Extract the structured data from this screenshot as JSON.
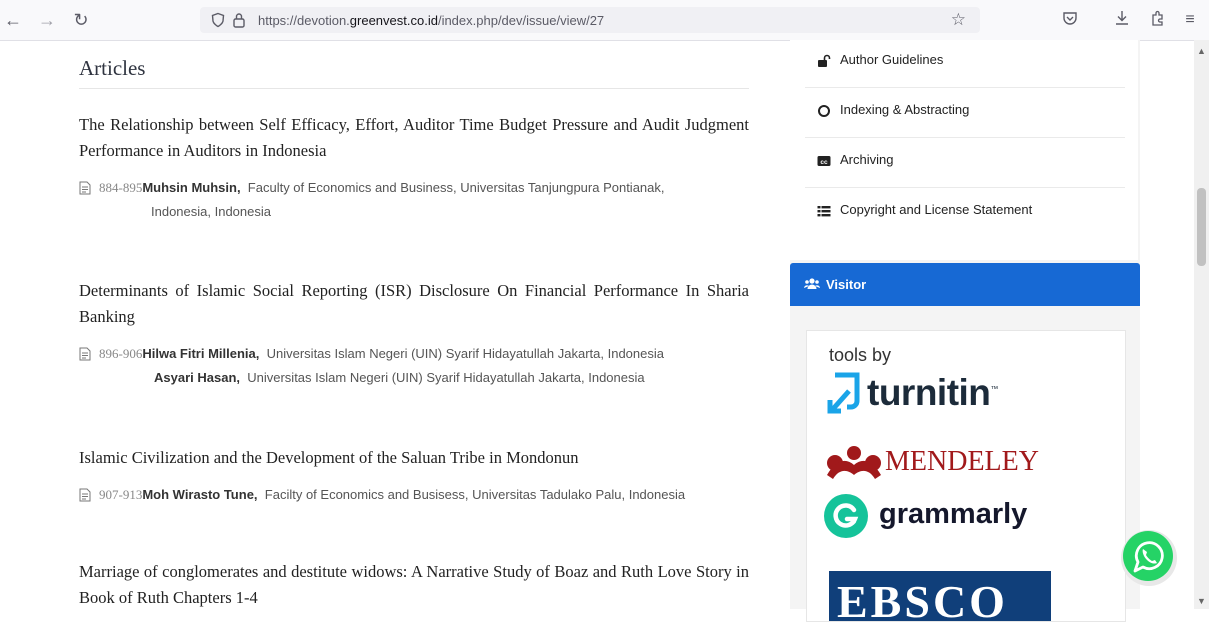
{
  "browser": {
    "url_prefix": "https://devotion.",
    "url_domain": "greenvest.co.id",
    "url_path": "/index.php/dev/issue/view/27"
  },
  "main": {
    "section_title": "Articles",
    "articles": [
      {
        "title": "The Relationship between Self Efficacy, Effort, Auditor Time Budget Pressure and Audit Judgment Performance in Auditors in Indonesia",
        "pages": "884-895",
        "author1": "Muhsin Muhsin,",
        "affil1": "Faculty of Economics and Business, Universitas Tanjungpura Pontianak,",
        "affil1_cont": "Indonesia,  Indonesia"
      },
      {
        "title": "Determinants of Islamic Social Reporting (ISR) Disclosure On Financial Performance In Sharia Banking",
        "pages": "896-906",
        "author1": "Hilwa Fitri Millenia,",
        "affil1": "Universitas Islam Negeri (UIN) Syarif Hidayatullah Jakarta,  Indonesia",
        "author2": "Asyari Hasan,",
        "affil2": "Universitas Islam Negeri (UIN) Syarif Hidayatullah Jakarta,  Indonesia"
      },
      {
        "title": "Islamic Civilization and the Development of the Saluan Tribe in Mondonun",
        "pages": "907-913",
        "author1": "Moh Wirasto Tune,",
        "affil1": "Facilty of Economics and Busisess, Universitas Tadulako Palu,  Indonesia"
      },
      {
        "title": "Marriage of conglomerates and destitute widows: A Narrative Study of Boaz and Ruth Love Story in Book of Ruth Chapters 1-4"
      }
    ]
  },
  "sidebar": {
    "menu": [
      {
        "label": "Author Guidelines",
        "icon": "unlock-icon"
      },
      {
        "label": "Indexing & Abstracting",
        "icon": "circle-icon"
      },
      {
        "label": "Archiving",
        "icon": "cc-icon"
      },
      {
        "label": "Copyright and License Statement",
        "icon": "list-icon"
      }
    ],
    "visitor_label": "Visitor",
    "tools_by": "tools by",
    "logos": {
      "turnitin": "turnitin",
      "turnitin_tm": "™",
      "mendeley": "MENDELEY",
      "grammarly": "grammarly",
      "ebsco": "EBSCO"
    }
  },
  "colors": {
    "accent": "#1769d4",
    "whatsapp": "#25d366"
  }
}
